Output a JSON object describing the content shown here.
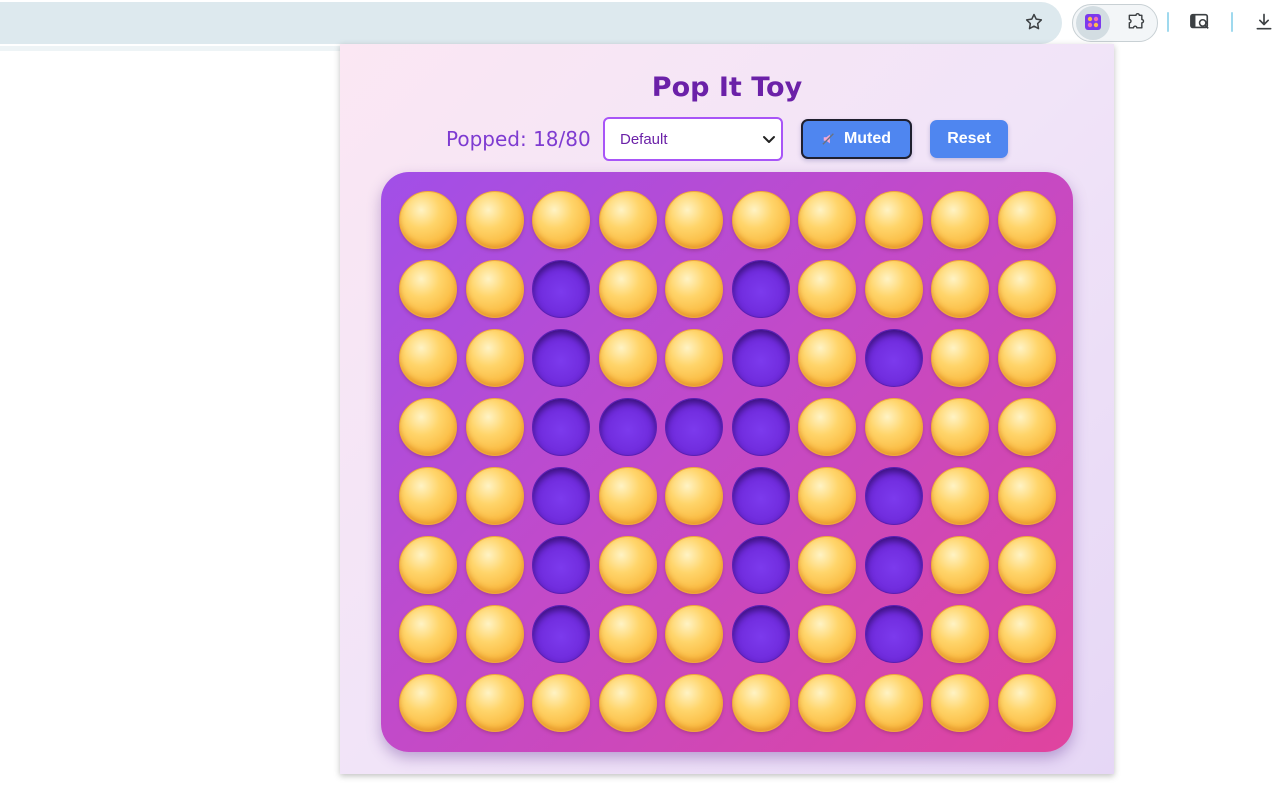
{
  "browser": {
    "toolbar_icons": [
      "star-icon",
      "extension-app-icon",
      "puzzle-icon",
      "tab-search-icon",
      "download-icon"
    ]
  },
  "popup": {
    "title": "Pop It Toy",
    "counter_label": "Popped: 18/80",
    "theme_selected": "Default",
    "mute_label": "Muted",
    "reset_label": "Reset"
  },
  "board": {
    "rows": 8,
    "cols": 10,
    "grid": [
      "..........",
      "..X..X....",
      "..X..X.X..",
      "..XXXX....",
      "..X..X.X..",
      "..X..X.X..",
      "..X..X.X..",
      ".........."
    ]
  },
  "colors": {
    "accent": "#6b21a8",
    "button": "#4f86f0",
    "bubble": "#fbbf48",
    "popped": "#6d28d9"
  }
}
